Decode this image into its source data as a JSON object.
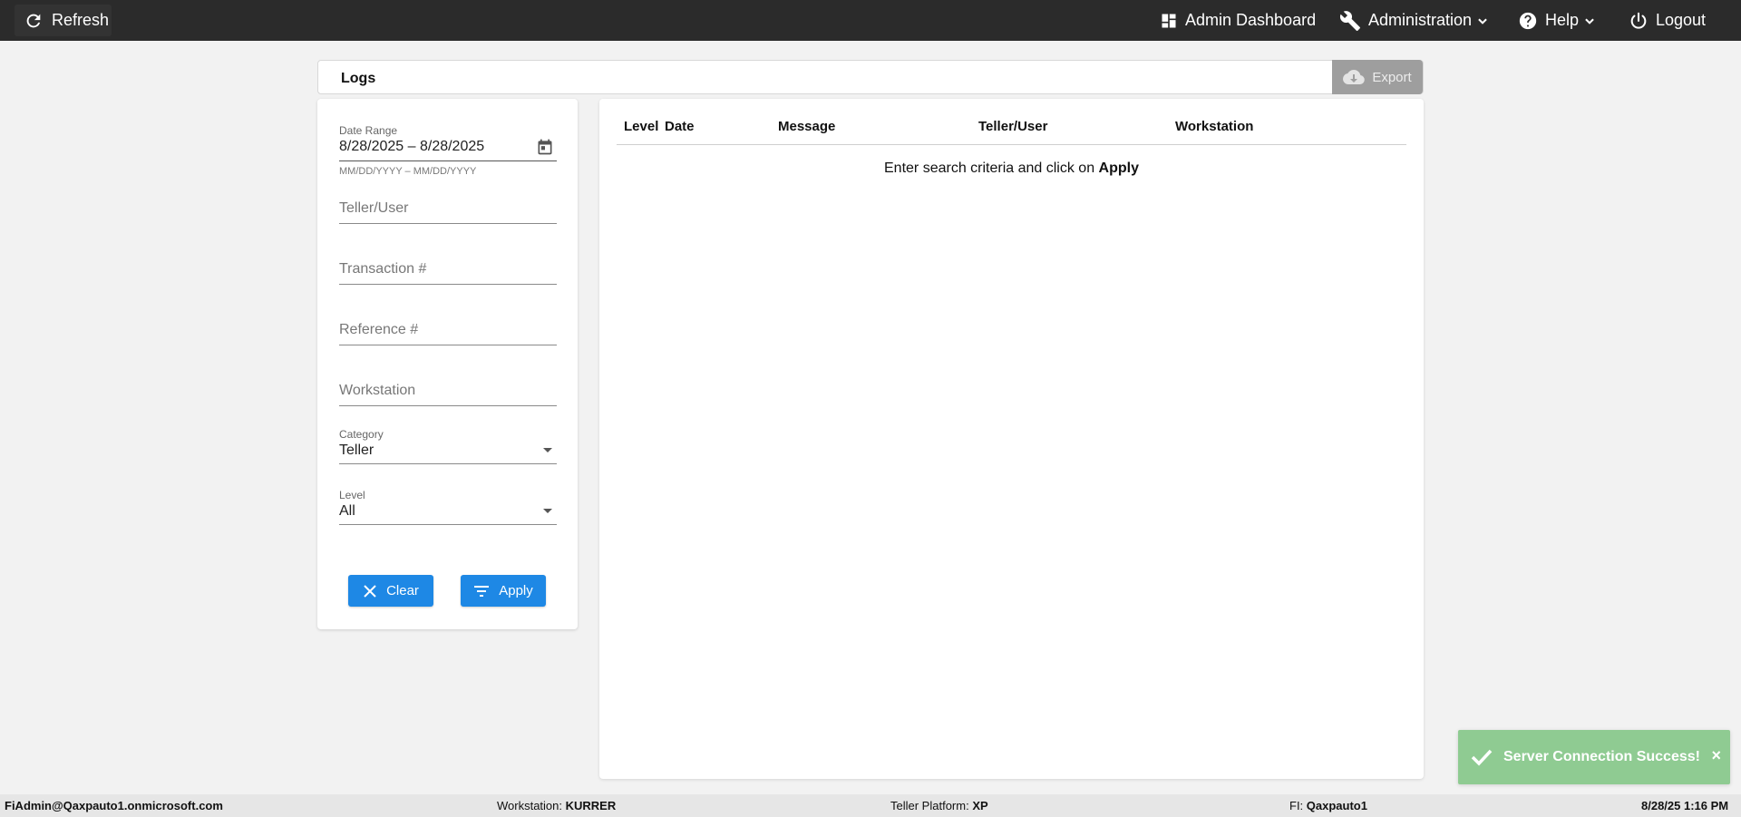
{
  "topbar": {
    "refresh_label": "Refresh",
    "admin_dashboard_label": "Admin Dashboard",
    "administration_label": "Administration",
    "help_label": "Help",
    "logout_label": "Logout"
  },
  "logs_header": {
    "title": "Logs",
    "export_label": "Export"
  },
  "filters": {
    "date_range": {
      "label": "Date Range",
      "value": "8/28/2025 – 8/28/2025",
      "hint": "MM/DD/YYYY – MM/DD/YYYY"
    },
    "teller_user_placeholder": "Teller/User",
    "transaction_placeholder": "Transaction #",
    "reference_placeholder": "Reference #",
    "workstation_placeholder": "Workstation",
    "category": {
      "label": "Category",
      "value": "Teller"
    },
    "level": {
      "label": "Level",
      "value": "All"
    },
    "clear_label": "Clear",
    "apply_label": "Apply"
  },
  "results": {
    "columns": [
      "Level",
      "Date",
      "Message",
      "Teller/User",
      "Workstation"
    ],
    "empty_prefix": "Enter search criteria and click on ",
    "empty_action": "Apply"
  },
  "toast": {
    "message": "Server Connection Success!",
    "close": "×",
    "color": "#8fcb92"
  },
  "footer": {
    "user": "FiAdmin@Qaxpauto1.onmicrosoft.com",
    "workstation_label": "Workstation: ",
    "workstation_value": "KURRER",
    "platform_label": "Teller Platform: ",
    "platform_value": "XP",
    "fi_label": "FI: ",
    "fi_value": "Qaxpauto1",
    "datetime": "8/28/25 1:16 PM"
  },
  "colors": {
    "topbar": "#2b2b2b",
    "primary_button": "#1e88e5",
    "export_disabled": "#9e9e9e",
    "background": "#f2f2f2"
  }
}
